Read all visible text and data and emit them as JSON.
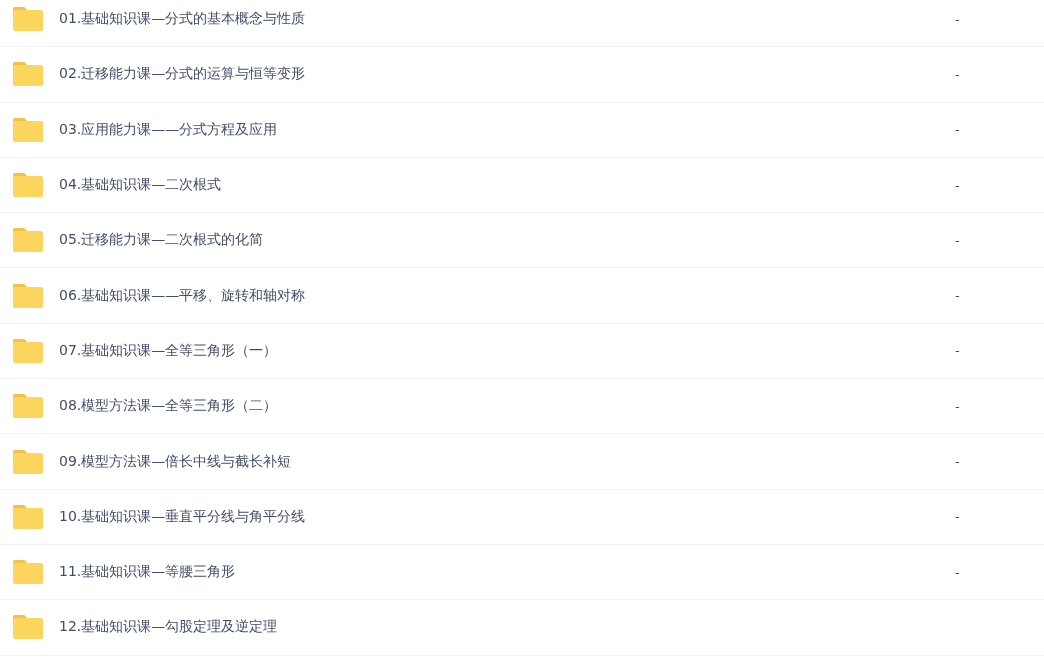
{
  "files": [
    {
      "name": "01.基础知识课—分式的基本概念与性质",
      "size": "-"
    },
    {
      "name": "02.迁移能力课—分式的运算与恒等变形",
      "size": "-"
    },
    {
      "name": "03.应用能力课——分式方程及应用",
      "size": "-"
    },
    {
      "name": "04.基础知识课—二次根式",
      "size": "-"
    },
    {
      "name": "05.迁移能力课—二次根式的化简",
      "size": "-"
    },
    {
      "name": "06.基础知识课——平移、旋转和轴对称",
      "size": "-"
    },
    {
      "name": "07.基础知识课—全等三角形（一）",
      "size": "-"
    },
    {
      "name": "08.模型方法课—全等三角形（二）",
      "size": "-"
    },
    {
      "name": "09.模型方法课—倍长中线与截长补短",
      "size": "-"
    },
    {
      "name": "10.基础知识课—垂直平分线与角平分线",
      "size": "-"
    },
    {
      "name": "11.基础知识课—等腰三角形",
      "size": "-"
    },
    {
      "name": "12.基础知识课—勾股定理及逆定理"
    }
  ]
}
